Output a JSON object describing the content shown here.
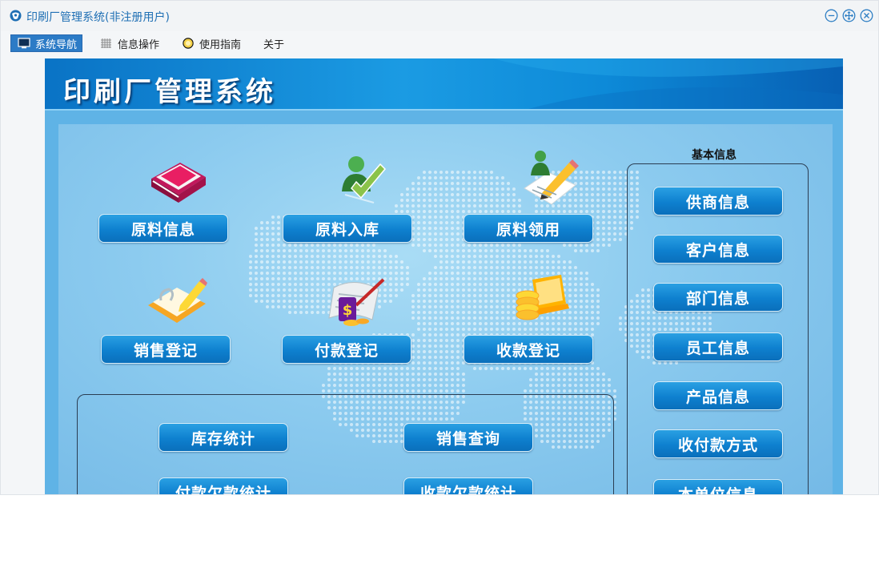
{
  "window": {
    "title": "印刷厂管理系统(非注册用户)",
    "controls": [
      "minimize",
      "maximize",
      "close"
    ]
  },
  "menu": {
    "items": [
      {
        "label": "系统导航",
        "icon": "monitor-icon",
        "active": true
      },
      {
        "label": "信息操作",
        "icon": "grid-icon",
        "active": false
      },
      {
        "label": "使用指南",
        "icon": "lightbulb-icon",
        "active": false
      },
      {
        "label": "关于",
        "icon": "",
        "active": false
      }
    ]
  },
  "banner": {
    "title": "印刷厂管理系统"
  },
  "main_buttons": [
    {
      "label": "原料信息",
      "icon": "book-icon"
    },
    {
      "label": "原料入库",
      "icon": "user-check-icon"
    },
    {
      "label": "原料领用",
      "icon": "user-edit-icon"
    },
    {
      "label": "销售登记",
      "icon": "notepad-icon"
    },
    {
      "label": "付款登记",
      "icon": "money-scroll-icon"
    },
    {
      "label": "收款登记",
      "icon": "coins-laptop-icon"
    }
  ],
  "stats_buttons": [
    {
      "label": "库存统计"
    },
    {
      "label": "销售查询"
    },
    {
      "label": "付款欠款统计"
    },
    {
      "label": "收款欠款统计"
    }
  ],
  "basic_info": {
    "label": "基本信息",
    "buttons": [
      {
        "label": "供商信息"
      },
      {
        "label": "客户信息"
      },
      {
        "label": "部门信息"
      },
      {
        "label": "员工信息"
      },
      {
        "label": "产品信息"
      },
      {
        "label": "收付款方式"
      },
      {
        "label": "本单位信息"
      }
    ]
  },
  "colors": {
    "accent": "#2c7bc6",
    "button": "#0e80cf",
    "banner": "#1b9be3",
    "panel": "#8ccbef"
  }
}
